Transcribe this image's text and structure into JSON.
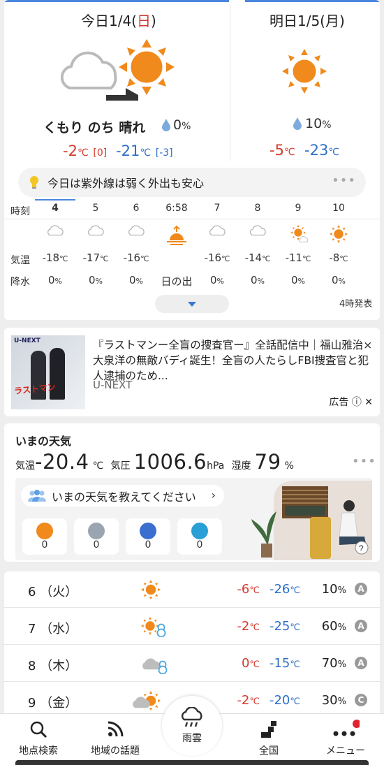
{
  "today": {
    "title": "今日1/4(",
    "title_day": "日",
    "title_close": ")",
    "description": "くもり のち 晴れ",
    "rain_prob": "0",
    "rain_unit": "%",
    "high": "-2",
    "high_diff": "[0]",
    "low": "-21",
    "low_diff": "[-3]",
    "temp_unit": "℃"
  },
  "tomorrow": {
    "title": "明日1/5(月)",
    "rain_prob": "10",
    "rain_unit": "%",
    "high": "-5",
    "low": "-23",
    "temp_unit": "℃"
  },
  "uv_message": "今日は紫外線は弱く外出も安心",
  "hourly": {
    "row_label_time": "時刻",
    "row_label_temp": "気温",
    "row_label_precip": "降水",
    "hours": [
      {
        "time": "4",
        "icon": "cloud-icon",
        "temp": "-18",
        "precip": "0",
        "unit_t": "℃",
        "unit_p": "%"
      },
      {
        "time": "5",
        "icon": "cloud-icon",
        "temp": "-17",
        "precip": "0",
        "unit_t": "℃",
        "unit_p": "%"
      },
      {
        "time": "6",
        "icon": "cloud-icon",
        "temp": "-16",
        "precip": "0",
        "unit_t": "℃",
        "unit_p": "%"
      },
      {
        "time": "6:58",
        "icon": "sunrise-icon",
        "temp": "",
        "precip": "日の出",
        "unit_t": "",
        "unit_p": ""
      },
      {
        "time": "7",
        "icon": "cloud-icon",
        "temp": "-16",
        "precip": "0",
        "unit_t": "℃",
        "unit_p": "%"
      },
      {
        "time": "8",
        "icon": "cloud-icon",
        "temp": "-14",
        "precip": "0",
        "unit_t": "℃",
        "unit_p": "%"
      },
      {
        "time": "9",
        "icon": "sun-cloud-icon",
        "temp": "-11",
        "precip": "0",
        "unit_t": "℃",
        "unit_p": "%"
      },
      {
        "time": "10",
        "icon": "sun-icon",
        "temp": "-8",
        "precip": "0",
        "unit_t": "℃",
        "unit_p": "%"
      }
    ],
    "issued": "4時発表"
  },
  "ad": {
    "brand": "U-NEXT",
    "thumb_title": "ラストマン",
    "text": "『ラストマンー全盲の捜査官ー』全話配信中｜福山雅治×大泉洋の無敵バディ誕生！全盲の人たらしFBI捜査官と犯人逮捕のため...",
    "source": "U-NEXT",
    "label": "広告"
  },
  "now": {
    "title": "いまの天気",
    "temp_label": "気温",
    "temp": "-20.4",
    "temp_unit": "℃",
    "pressure_label": "気圧",
    "pressure": "1006.6",
    "pressure_unit": "hPa",
    "humidity_label": "湿度",
    "humidity": "79",
    "humidity_unit": "%",
    "ask": "いまの天気を教えてください",
    "reports": [
      {
        "icon": "sun-report-icon",
        "count": "0"
      },
      {
        "icon": "cloud-report-icon",
        "count": "0"
      },
      {
        "icon": "rain-report-icon",
        "count": "0"
      },
      {
        "icon": "snow-report-icon",
        "count": "0"
      }
    ]
  },
  "weekly": [
    {
      "date": "6 （火）",
      "icon": "sun-icon",
      "high": "-6",
      "low": "-26",
      "precip": "10",
      "grade": "A"
    },
    {
      "date": "7 （水）",
      "icon": "sun-snow-icon",
      "high": "-2",
      "low": "-25",
      "precip": "60",
      "grade": "A"
    },
    {
      "date": "8 （木）",
      "icon": "cloud-snow-icon",
      "high": "0",
      "low": "-15",
      "precip": "70",
      "grade": "A"
    },
    {
      "date": "9 （金）",
      "icon": "cloud-sun-icon",
      "high": "-2",
      "low": "-20",
      "precip": "30",
      "grade": "C"
    }
  ],
  "units": {
    "temp": "℃",
    "percent": "%"
  },
  "nav": {
    "search": "地点検索",
    "local": "地域の話題",
    "rain": "雨雲",
    "national": "全国",
    "menu": "メニュー"
  },
  "colors": {
    "accent": "#4a86e0",
    "high": "#d33a2c",
    "low": "#2d6fc9",
    "sun": "#f08a1c"
  }
}
